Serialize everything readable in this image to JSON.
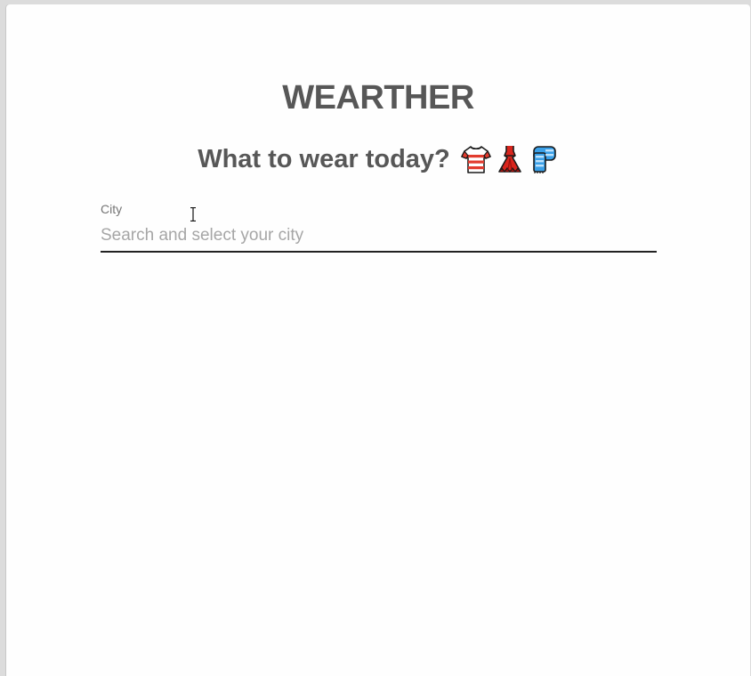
{
  "app": {
    "title": "WEARTHER",
    "subtitle": "What to wear today?"
  },
  "subtitle_emojis": [
    "tshirt-icon",
    "dress-icon",
    "scarf-icon"
  ],
  "city_field": {
    "label": "City",
    "placeholder": "Search and select your city",
    "value": ""
  },
  "colors": {
    "heading": "#575757",
    "label": "#757575",
    "placeholder": "#a6a6a6",
    "underline": "#222222",
    "background": "#fefefe"
  }
}
